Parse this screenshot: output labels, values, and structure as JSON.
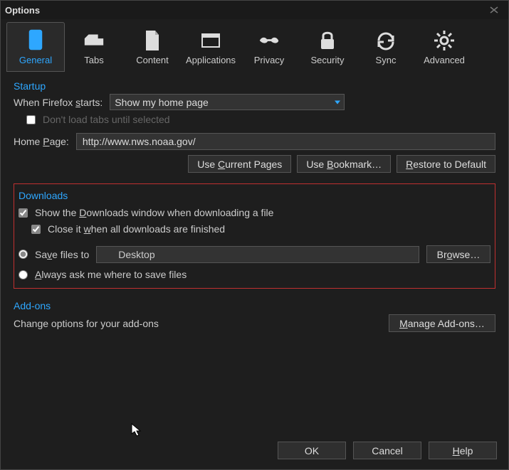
{
  "window": {
    "title": "Options"
  },
  "tabs": [
    {
      "id": "general",
      "label": "General"
    },
    {
      "id": "tabs",
      "label": "Tabs"
    },
    {
      "id": "content",
      "label": "Content"
    },
    {
      "id": "applications",
      "label": "Applications"
    },
    {
      "id": "privacy",
      "label": "Privacy"
    },
    {
      "id": "security",
      "label": "Security"
    },
    {
      "id": "sync",
      "label": "Sync"
    },
    {
      "id": "advanced",
      "label": "Advanced"
    }
  ],
  "startup": {
    "title": "Startup",
    "when_label_pre": "When Firefox ",
    "when_label_underline": "s",
    "when_label_post": "tarts:",
    "when_value": "Show my home page",
    "dont_load_label": "Don't load tabs until selected",
    "home_label_pre": "Home ",
    "home_label_underline": "P",
    "home_label_post": "age:",
    "home_value": "http://www.nws.noaa.gov/",
    "btn_current_pre": "Use ",
    "btn_current_u": "C",
    "btn_current_post": "urrent Pages",
    "btn_bookmark_pre": "Use ",
    "btn_bookmark_u": "B",
    "btn_bookmark_post": "ookmark…",
    "btn_restore_pre": "",
    "btn_restore_u": "R",
    "btn_restore_post": "estore to Default"
  },
  "downloads": {
    "title": "Downloads",
    "show_pre": "Show the ",
    "show_u": "D",
    "show_post": "ownloads window when downloading a file",
    "close_pre": "Close it ",
    "close_u": "w",
    "close_post": "hen all downloads are finished",
    "saveto_pre": "Sa",
    "saveto_u": "v",
    "saveto_post": "e files to",
    "saveto_path": "Desktop",
    "browse_pre": "Br",
    "browse_u": "o",
    "browse_post": "wse…",
    "ask_pre": "",
    "ask_u": "A",
    "ask_post": "lways ask me where to save files"
  },
  "addons": {
    "title": "Add-ons",
    "desc": "Change options for your add-ons",
    "btn_pre": "",
    "btn_u": "M",
    "btn_post": "anage Add-ons…"
  },
  "footer": {
    "ok": "OK",
    "cancel": "Cancel",
    "help_u": "H",
    "help_post": "elp"
  }
}
